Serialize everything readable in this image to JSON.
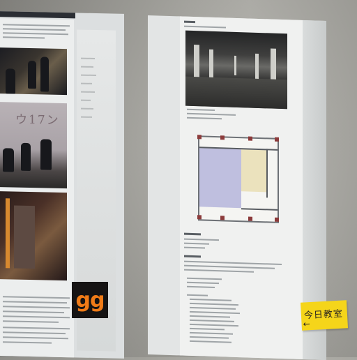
{
  "scene": {
    "left_sheet": {
      "photos": [
        {
          "name": "dark-performance-photo"
        },
        {
          "name": "graffiti-wall-photo",
          "graffiti_text": "ウ17ン"
        },
        {
          "name": "red-stage-photo"
        }
      ],
      "logo_text": "gg"
    },
    "right_sheet": {
      "photo": "empty-hall-photo",
      "floor_plan": "venue-floor-plan"
    },
    "sticky_note": {
      "text": "今日教室",
      "arrow": "←",
      "color": "#f5d51a"
    },
    "colors": {
      "logo_text": "#f07b17",
      "logo_bg": "#151313",
      "plan_yellow": "#ebe2bd",
      "plan_purple": "#bfbfdf"
    }
  }
}
